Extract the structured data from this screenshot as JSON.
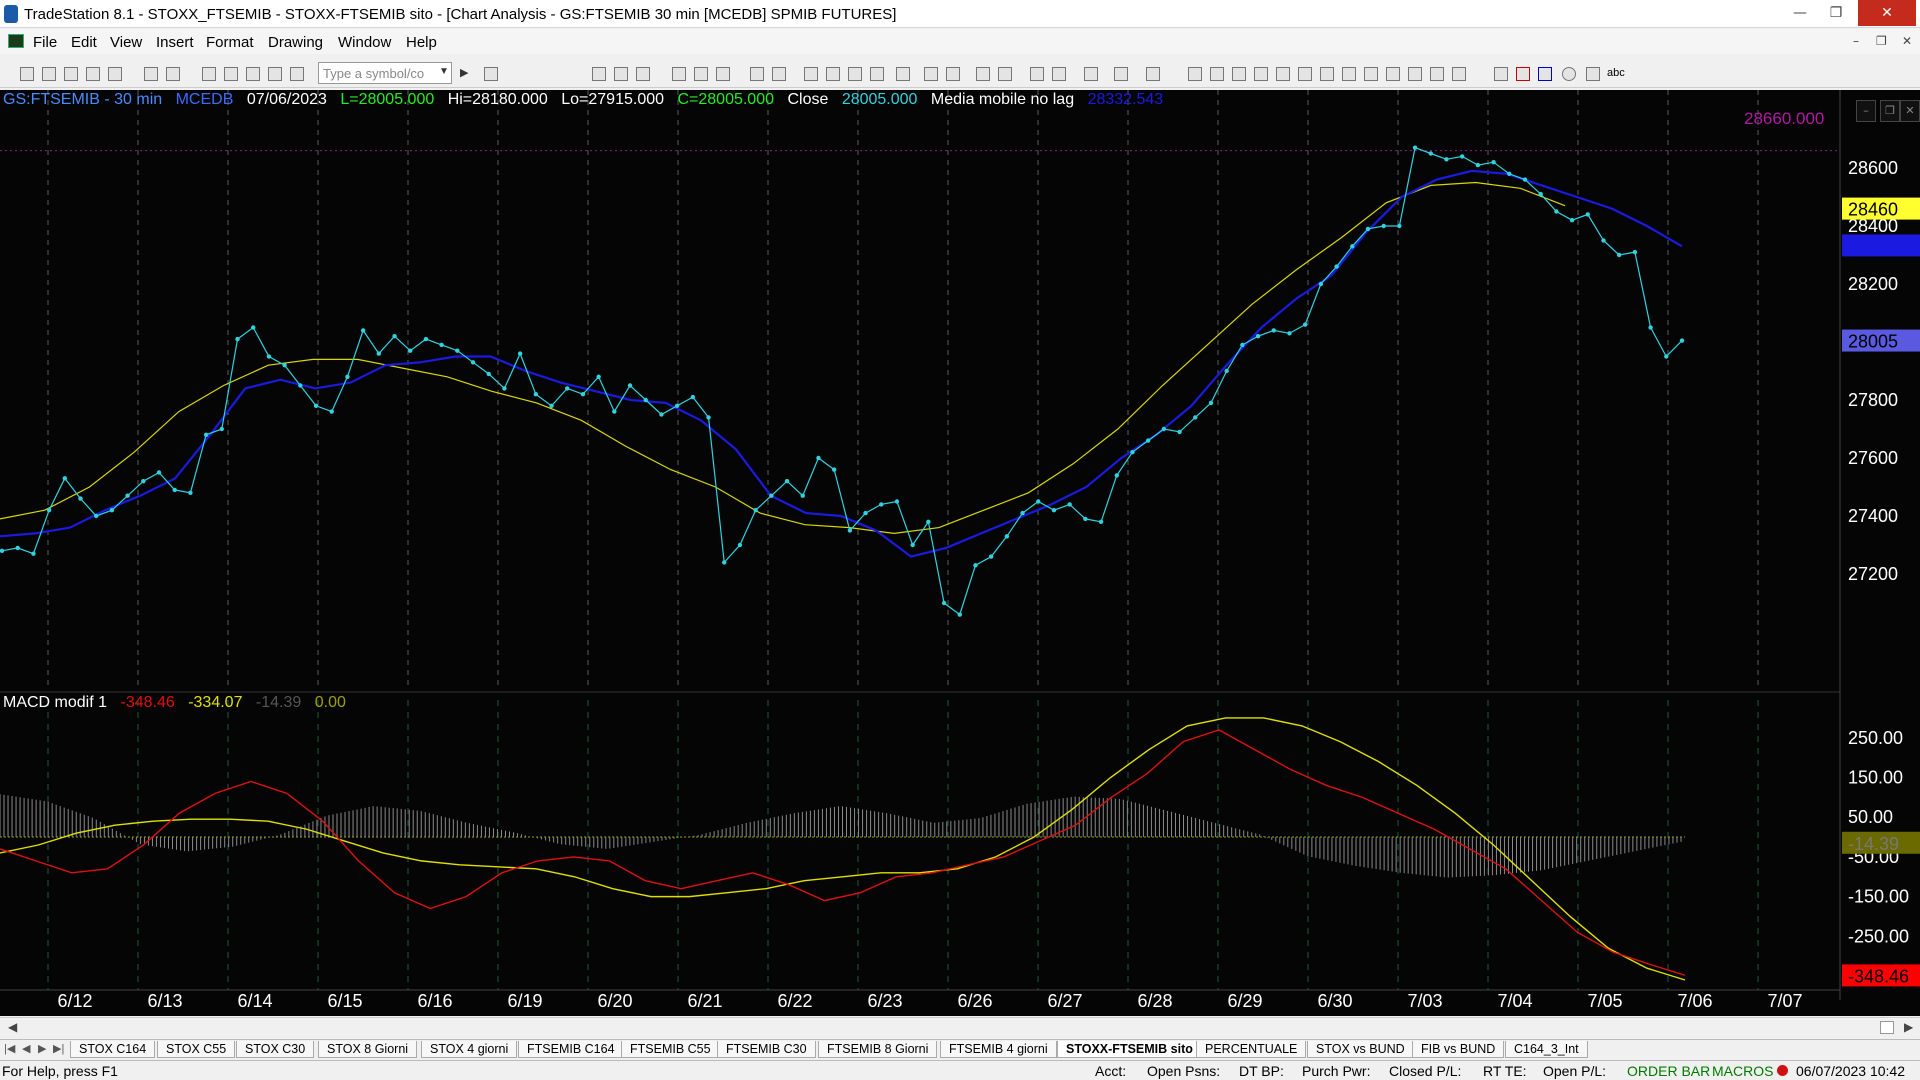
{
  "window": {
    "title": "TradeStation 8.1 - STOXX_FTSEMIB - STOXX-FTSEMIB sito - [Chart Analysis - GS:FTSEMIB  30 min  [MCEDB] SPMIB FUTURES]",
    "minimize": "—",
    "restore": "❐",
    "close": "✕"
  },
  "menu": {
    "items": [
      "File",
      "Edit",
      "View",
      "Insert",
      "Format",
      "Drawing",
      "Window",
      "Help"
    ],
    "mdi_minimize": "–",
    "mdi_restore": "❐",
    "mdi_close": "✕"
  },
  "toolbar": {
    "symbol_placeholder": "Type a symbol/co",
    "abc_label": "abc"
  },
  "chart_header": {
    "symbol": "GS:FTSEMIB - 30 min",
    "style": "MCEDB",
    "date": "07/06/2023",
    "last": "L=28005.000",
    "high": "Hi=28180.000",
    "low": "Lo=27915.000",
    "close_eq": "C=28005.000",
    "close_label": "Close",
    "close_value": "28005.000",
    "indicator": "Media mobile no lag",
    "indicator_value": "28332.543",
    "top_marker": "28660.000"
  },
  "macd_header": {
    "name": "MACD modif 1",
    "macd": "-348.46",
    "signal": "-334.07",
    "hist": "-14.39",
    "zero": "0.00"
  },
  "colors": {
    "price": "#2fd3e0",
    "ma_blue": "#1a1ae0",
    "ma_yellow": "#d8d800",
    "macd_red": "#e01010",
    "signal_yellow": "#e0e000",
    "hist": "#8a8a8a",
    "axis_text": "#ffffff",
    "background": "#050505"
  },
  "chart_data": [
    {
      "type": "line",
      "title": "GS:FTSEMIB - 30 min",
      "x": [
        "6/12",
        "6/13",
        "6/14",
        "6/15",
        "6/16",
        "6/19",
        "6/20",
        "6/21",
        "6/22",
        "6/23",
        "6/26",
        "6/27",
        "6/28",
        "6/29",
        "6/30",
        "7/03",
        "7/04",
        "7/05",
        "7/06",
        "7/07"
      ],
      "y_ticks": [
        27200,
        27400,
        27600,
        27800,
        28000,
        28200,
        28400,
        28600
      ],
      "ylim": [
        26800,
        28800
      ],
      "grid": "vertical dashed",
      "price_markers": [
        {
          "label": "28460",
          "value": 28460,
          "bg": "#ffff30",
          "fg": "#000000"
        },
        {
          "label": "28333",
          "value": 28333,
          "bg": "#1a1ae0",
          "fg": "#1a1ae0"
        },
        {
          "label": "28005",
          "value": 28005,
          "bg": "#5a5ae0",
          "fg": "#000000"
        }
      ],
      "reference_line": 28660,
      "series": [
        {
          "name": "Close",
          "color": "#2fd3e0",
          "values": [
            27280,
            27290,
            27270,
            27420,
            27530,
            27460,
            27400,
            27420,
            27470,
            27520,
            27550,
            27490,
            27480,
            27680,
            27700,
            28010,
            28050,
            27950,
            27920,
            27850,
            27780,
            27760,
            27880,
            28040,
            27960,
            28020,
            27970,
            28010,
            27990,
            27970,
            27930,
            27890,
            27840,
            27960,
            27820,
            27780,
            27840,
            27820,
            27880,
            27760,
            27850,
            27800,
            27750,
            27780,
            27810,
            27740,
            27240,
            27300,
            27420,
            27470,
            27520,
            27470,
            27600,
            27560,
            27350,
            27410,
            27440,
            27450,
            27300,
            27380,
            27100,
            27060,
            27230,
            27260,
            27330,
            27410,
            27450,
            27420,
            27440,
            27390,
            27380,
            27540,
            27620,
            27660,
            27700,
            27690,
            27740,
            27790,
            27900,
            27990,
            28020,
            28040,
            28030,
            28060,
            28200,
            28260,
            28330,
            28390,
            28400,
            28400,
            28670,
            28650,
            28630,
            28640,
            28610,
            28620,
            28580,
            28560,
            28510,
            28450,
            28420,
            28440,
            28350,
            28300,
            28310,
            28050,
            27950,
            28005
          ]
        },
        {
          "name": "Media mobile no lag",
          "color": "#1a1ae0",
          "values": [
            27330,
            27340,
            27360,
            27420,
            27470,
            27530,
            27680,
            27840,
            27870,
            27840,
            27860,
            27920,
            27930,
            27950,
            27950,
            27900,
            27860,
            27830,
            27800,
            27790,
            27730,
            27630,
            27470,
            27410,
            27400,
            27350,
            27260,
            27290,
            27340,
            27390,
            27440,
            27500,
            27600,
            27680,
            27780,
            27920,
            28050,
            28150,
            28230,
            28380,
            28500,
            28560,
            28590,
            28580,
            28540,
            28500,
            28460,
            28400,
            28330
          ]
        },
        {
          "name": "",
          "color": "#d8d800",
          "values": [
            27390,
            27420,
            27500,
            27620,
            27760,
            27850,
            27920,
            27940,
            27940,
            27910,
            27880,
            27830,
            27790,
            27730,
            27640,
            27560,
            27500,
            27410,
            27370,
            27360,
            27340,
            27360,
            27420,
            27480,
            27580,
            27700,
            27850,
            27990,
            28130,
            28250,
            28360,
            28480,
            28540,
            28550,
            28530,
            28470
          ]
        }
      ]
    },
    {
      "type": "line",
      "title": "MACD modif 1",
      "y_ticks": [
        250,
        150,
        50,
        -50,
        -150,
        -250
      ],
      "ylim": [
        -360,
        320
      ],
      "value_markers": [
        {
          "label": "-14.39",
          "value": -14.39,
          "bg": "#6a6a00",
          "fg": "#777777"
        },
        {
          "label": "-348.46",
          "value": -348.46,
          "bg": "#ff0000",
          "fg": "#000000"
        }
      ],
      "series": [
        {
          "name": "MACD",
          "color": "#e01010",
          "values": [
            -30,
            -60,
            -90,
            -80,
            -20,
            60,
            110,
            140,
            110,
            40,
            -60,
            -140,
            -180,
            -150,
            -90,
            -60,
            -50,
            -60,
            -110,
            -130,
            -110,
            -90,
            -120,
            -160,
            -140,
            -100,
            -90,
            -70,
            -50,
            -10,
            30,
            100,
            160,
            240,
            270,
            220,
            170,
            130,
            100,
            60,
            20,
            -30,
            -80,
            -160,
            -240,
            -290,
            -320,
            -348
          ]
        },
        {
          "name": "Signal",
          "color": "#e0e000",
          "values": [
            -40,
            -20,
            10,
            30,
            40,
            45,
            45,
            40,
            20,
            -10,
            -40,
            -60,
            -70,
            -75,
            -80,
            -100,
            -130,
            -150,
            -150,
            -140,
            -130,
            -110,
            -100,
            -90,
            -90,
            -80,
            -50,
            0,
            70,
            150,
            220,
            280,
            300,
            300,
            280,
            240,
            190,
            130,
            60,
            -20,
            -110,
            -200,
            -280,
            -330,
            -360
          ]
        },
        {
          "name": "Histogram",
          "color": "#8a8a8a",
          "values": [
            180,
            150,
            80,
            -30,
            -60,
            -40,
            10,
            90,
            130,
            110,
            60,
            20,
            -30,
            -50,
            -20,
            10,
            60,
            100,
            130,
            100,
            60,
            80,
            140,
            170,
            160,
            110,
            60,
            10,
            -80,
            -120,
            -150,
            -170,
            -160,
            -140,
            -100,
            -60,
            -20
          ]
        }
      ]
    }
  ],
  "tabs": {
    "nav": [
      "|◀",
      "◀",
      "▶",
      "▶|"
    ],
    "items": [
      "STOX C164",
      "STOX C55",
      "STOX  C30",
      "STOX  8 Giorni",
      "STOX 4 giorni",
      "FTSEMIB C164",
      "FTSEMIB C55",
      "FTSEMIB C30",
      "FTSEMIB  8 Giorni",
      "FTSEMIB  4 giorni",
      "STOXX-FTSEMIB sito",
      "PERCENTUALE",
      "STOX vs BUND",
      "FIB vs BUND",
      "C164_3_Int"
    ],
    "active": "STOXX-FTSEMIB sito"
  },
  "statusbar": {
    "help": "For Help, press F1",
    "acct": "Acct:",
    "open_psns": "Open Psns:",
    "dt_bp": "DT BP:",
    "purch_pwr": "Purch Pwr:",
    "closed_pl": "Closed P/L:",
    "rt_te": "RT TE:",
    "open_pl": "Open P/L:",
    "order_bar": "ORDER BAR",
    "macros": "MACROS",
    "datetime": "06/07/2023 10:42"
  }
}
